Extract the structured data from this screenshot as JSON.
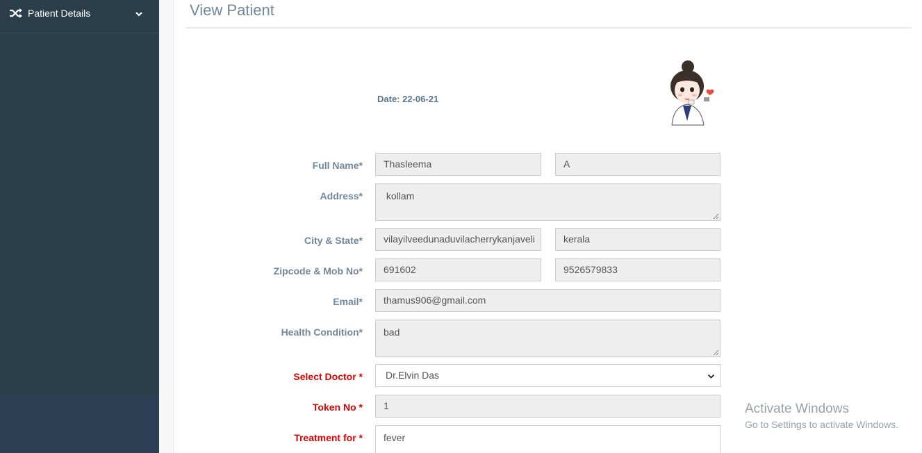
{
  "sidebar": {
    "menu_label": "Patient Details",
    "menu_icon": "shuffle-icon",
    "menu_toggle_icon": "chevron-down-icon",
    "color": "#2a3f4a"
  },
  "page": {
    "title": "View Patient",
    "date": "Date: 22-06-21"
  },
  "form": {
    "full_name": {
      "label": "Full Name*",
      "first": "Thasleema",
      "last": "A"
    },
    "address": {
      "label": "Address*",
      "value": " kollam"
    },
    "city_state": {
      "label": "City & State*",
      "city": "vilayilveedunaduvilacherrykanjaveli",
      "state": "kerala"
    },
    "zip_mob": {
      "label": "Zipcode & Mob No*",
      "zip": "691602",
      "mobile": "9526579833"
    },
    "email": {
      "label": "Email*",
      "value": "thamus906@gmail.com"
    },
    "health": {
      "label": "Health Condition*",
      "value": "bad"
    },
    "doctor": {
      "label": "Select Doctor *",
      "value": "Dr.Elvin Das"
    },
    "token": {
      "label": "Token No *",
      "value": "1"
    },
    "treatment": {
      "label": "Treatment for *",
      "value": "fever"
    }
  },
  "watermark": {
    "line1": "Activate Windows",
    "line2": "Go to Settings to activate Windows."
  },
  "colors": {
    "label": "#73879c",
    "required_label": "#e10000",
    "field_bg": "#eeeeee"
  }
}
